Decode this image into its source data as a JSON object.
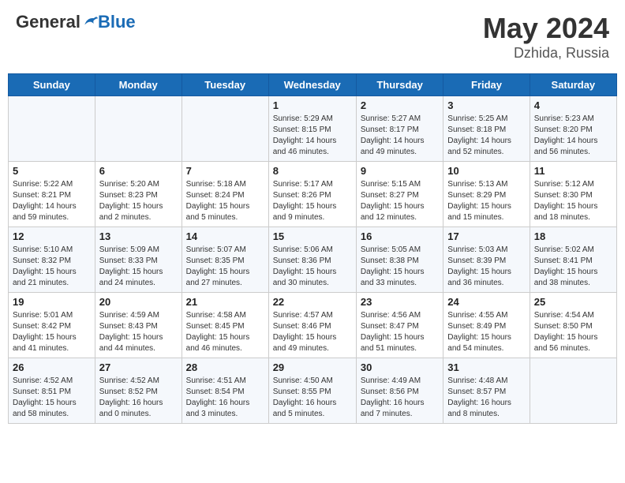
{
  "header": {
    "logo": {
      "general": "General",
      "blue": "Blue"
    },
    "title": "May 2024",
    "subtitle": "Dzhida, Russia"
  },
  "weekdays": [
    "Sunday",
    "Monday",
    "Tuesday",
    "Wednesday",
    "Thursday",
    "Friday",
    "Saturday"
  ],
  "weeks": [
    [
      {
        "day": "",
        "info": ""
      },
      {
        "day": "",
        "info": ""
      },
      {
        "day": "",
        "info": ""
      },
      {
        "day": "1",
        "info": "Sunrise: 5:29 AM\nSunset: 8:15 PM\nDaylight: 14 hours\nand 46 minutes."
      },
      {
        "day": "2",
        "info": "Sunrise: 5:27 AM\nSunset: 8:17 PM\nDaylight: 14 hours\nand 49 minutes."
      },
      {
        "day": "3",
        "info": "Sunrise: 5:25 AM\nSunset: 8:18 PM\nDaylight: 14 hours\nand 52 minutes."
      },
      {
        "day": "4",
        "info": "Sunrise: 5:23 AM\nSunset: 8:20 PM\nDaylight: 14 hours\nand 56 minutes."
      }
    ],
    [
      {
        "day": "5",
        "info": "Sunrise: 5:22 AM\nSunset: 8:21 PM\nDaylight: 14 hours\nand 59 minutes."
      },
      {
        "day": "6",
        "info": "Sunrise: 5:20 AM\nSunset: 8:23 PM\nDaylight: 15 hours\nand 2 minutes."
      },
      {
        "day": "7",
        "info": "Sunrise: 5:18 AM\nSunset: 8:24 PM\nDaylight: 15 hours\nand 5 minutes."
      },
      {
        "day": "8",
        "info": "Sunrise: 5:17 AM\nSunset: 8:26 PM\nDaylight: 15 hours\nand 9 minutes."
      },
      {
        "day": "9",
        "info": "Sunrise: 5:15 AM\nSunset: 8:27 PM\nDaylight: 15 hours\nand 12 minutes."
      },
      {
        "day": "10",
        "info": "Sunrise: 5:13 AM\nSunset: 8:29 PM\nDaylight: 15 hours\nand 15 minutes."
      },
      {
        "day": "11",
        "info": "Sunrise: 5:12 AM\nSunset: 8:30 PM\nDaylight: 15 hours\nand 18 minutes."
      }
    ],
    [
      {
        "day": "12",
        "info": "Sunrise: 5:10 AM\nSunset: 8:32 PM\nDaylight: 15 hours\nand 21 minutes."
      },
      {
        "day": "13",
        "info": "Sunrise: 5:09 AM\nSunset: 8:33 PM\nDaylight: 15 hours\nand 24 minutes."
      },
      {
        "day": "14",
        "info": "Sunrise: 5:07 AM\nSunset: 8:35 PM\nDaylight: 15 hours\nand 27 minutes."
      },
      {
        "day": "15",
        "info": "Sunrise: 5:06 AM\nSunset: 8:36 PM\nDaylight: 15 hours\nand 30 minutes."
      },
      {
        "day": "16",
        "info": "Sunrise: 5:05 AM\nSunset: 8:38 PM\nDaylight: 15 hours\nand 33 minutes."
      },
      {
        "day": "17",
        "info": "Sunrise: 5:03 AM\nSunset: 8:39 PM\nDaylight: 15 hours\nand 36 minutes."
      },
      {
        "day": "18",
        "info": "Sunrise: 5:02 AM\nSunset: 8:41 PM\nDaylight: 15 hours\nand 38 minutes."
      }
    ],
    [
      {
        "day": "19",
        "info": "Sunrise: 5:01 AM\nSunset: 8:42 PM\nDaylight: 15 hours\nand 41 minutes."
      },
      {
        "day": "20",
        "info": "Sunrise: 4:59 AM\nSunset: 8:43 PM\nDaylight: 15 hours\nand 44 minutes."
      },
      {
        "day": "21",
        "info": "Sunrise: 4:58 AM\nSunset: 8:45 PM\nDaylight: 15 hours\nand 46 minutes."
      },
      {
        "day": "22",
        "info": "Sunrise: 4:57 AM\nSunset: 8:46 PM\nDaylight: 15 hours\nand 49 minutes."
      },
      {
        "day": "23",
        "info": "Sunrise: 4:56 AM\nSunset: 8:47 PM\nDaylight: 15 hours\nand 51 minutes."
      },
      {
        "day": "24",
        "info": "Sunrise: 4:55 AM\nSunset: 8:49 PM\nDaylight: 15 hours\nand 54 minutes."
      },
      {
        "day": "25",
        "info": "Sunrise: 4:54 AM\nSunset: 8:50 PM\nDaylight: 15 hours\nand 56 minutes."
      }
    ],
    [
      {
        "day": "26",
        "info": "Sunrise: 4:52 AM\nSunset: 8:51 PM\nDaylight: 15 hours\nand 58 minutes."
      },
      {
        "day": "27",
        "info": "Sunrise: 4:52 AM\nSunset: 8:52 PM\nDaylight: 16 hours\nand 0 minutes."
      },
      {
        "day": "28",
        "info": "Sunrise: 4:51 AM\nSunset: 8:54 PM\nDaylight: 16 hours\nand 3 minutes."
      },
      {
        "day": "29",
        "info": "Sunrise: 4:50 AM\nSunset: 8:55 PM\nDaylight: 16 hours\nand 5 minutes."
      },
      {
        "day": "30",
        "info": "Sunrise: 4:49 AM\nSunset: 8:56 PM\nDaylight: 16 hours\nand 7 minutes."
      },
      {
        "day": "31",
        "info": "Sunrise: 4:48 AM\nSunset: 8:57 PM\nDaylight: 16 hours\nand 8 minutes."
      },
      {
        "day": "",
        "info": ""
      }
    ]
  ]
}
